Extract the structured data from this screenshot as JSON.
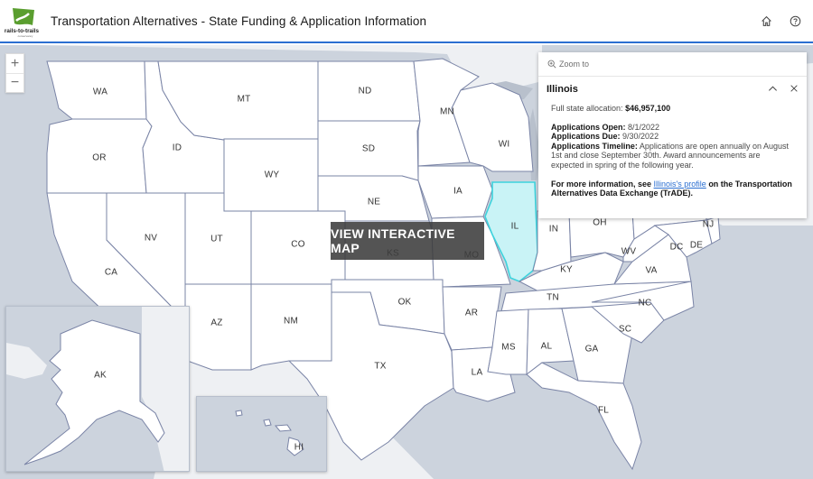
{
  "header": {
    "logo_alt": "rails-to-trails conservancy",
    "title": "Transportation Alternatives - State Funding & Application Information",
    "actions": [
      {
        "name": "home-icon",
        "label": "Home"
      },
      {
        "name": "help-icon",
        "label": "Help"
      }
    ]
  },
  "map": {
    "zoom_in": "+",
    "zoom_out": "−",
    "overlay_button": "VIEW INTERACTIVE MAP",
    "selected_state": "IL",
    "selected_color": "#c9f3f6",
    "state_labels": [
      {
        "code": "WA"
      },
      {
        "code": "OR"
      },
      {
        "code": "CA"
      },
      {
        "code": "ID"
      },
      {
        "code": "NV"
      },
      {
        "code": "MT"
      },
      {
        "code": "WY"
      },
      {
        "code": "UT"
      },
      {
        "code": "AZ"
      },
      {
        "code": "CO"
      },
      {
        "code": "NM"
      },
      {
        "code": "ND"
      },
      {
        "code": "SD"
      },
      {
        "code": "NE"
      },
      {
        "code": "KS"
      },
      {
        "code": "OK"
      },
      {
        "code": "TX"
      },
      {
        "code": "MN"
      },
      {
        "code": "IA"
      },
      {
        "code": "MO"
      },
      {
        "code": "AR"
      },
      {
        "code": "LA"
      },
      {
        "code": "WI"
      },
      {
        "code": "IL"
      },
      {
        "code": "IN"
      },
      {
        "code": "OH"
      },
      {
        "code": "KY"
      },
      {
        "code": "TN"
      },
      {
        "code": "MS"
      },
      {
        "code": "AL"
      },
      {
        "code": "GA"
      },
      {
        "code": "FL"
      },
      {
        "code": "SC"
      },
      {
        "code": "NC"
      },
      {
        "code": "VA"
      },
      {
        "code": "WV"
      },
      {
        "code": "DC"
      },
      {
        "code": "DE"
      },
      {
        "code": "NJ"
      },
      {
        "code": "AK"
      },
      {
        "code": "HI"
      }
    ]
  },
  "popup": {
    "zoom_to": "Zoom to",
    "title": "Illinois",
    "allocation_label": "Full state allocation:",
    "allocation_value": "$46,957,100",
    "open_label": "Applications Open:",
    "open_value": "8/1/2022",
    "due_label": "Applications Due:",
    "due_value": "9/30/2022",
    "timeline_label": "Applications Timeline:",
    "timeline_value": "Applications are open annually on August 1st and close September 30th. Award announcements are expected in spring of the following year.",
    "more_info_prefix": "For more information, see",
    "more_info_link": "Illinois's profile",
    "more_info_suffix": "on the Transportation Alternatives Data Exchange (TrADE)."
  }
}
